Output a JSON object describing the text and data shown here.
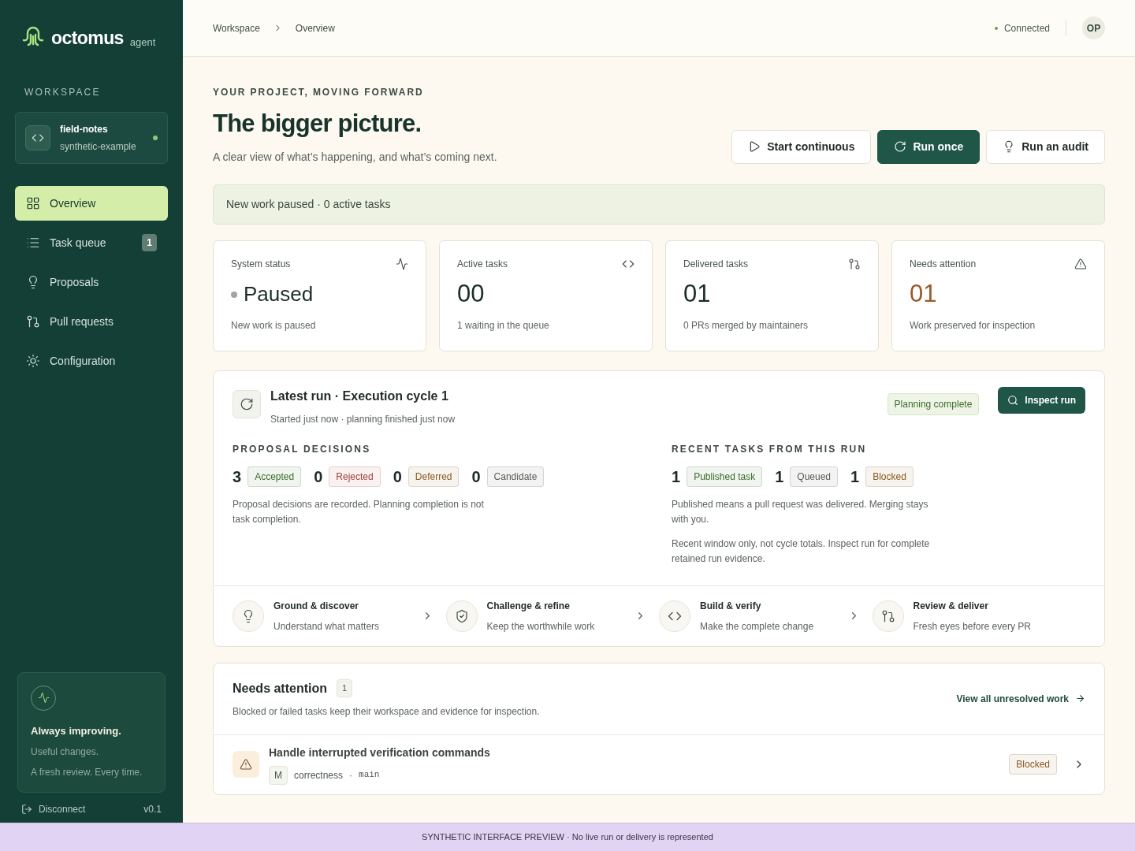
{
  "brand": {
    "name": "octomus",
    "suffix": "agent"
  },
  "sidebar": {
    "section_label": "WORKSPACE",
    "workspace": {
      "name": "field-notes",
      "subtitle": "synthetic-example",
      "online": true
    },
    "items": [
      {
        "label": "Overview",
        "selected": true
      },
      {
        "label": "Task queue",
        "selected": false,
        "badge": "1"
      },
      {
        "label": "Proposals",
        "selected": false
      },
      {
        "label": "Pull requests",
        "selected": false
      },
      {
        "label": "Configuration",
        "selected": false
      }
    ],
    "promo": {
      "title": "Always improving.",
      "lines": [
        "Useful changes.",
        "A fresh review. Every time."
      ]
    },
    "footer": {
      "disconnect": "Disconnect",
      "version": "v0.1"
    }
  },
  "header": {
    "breadcrumbs": [
      "Workspace",
      "Overview"
    ],
    "connection": {
      "label": "Connected",
      "connected": true
    },
    "avatar": "OP"
  },
  "hero": {
    "eyebrow": "YOUR PROJECT, MOVING FORWARD",
    "title": "The bigger picture.",
    "subtitle": "A clear view of what’s happening, and what’s coming next.",
    "buttons": [
      {
        "label": "Start continuous",
        "kind": "outline"
      },
      {
        "label": "Run once",
        "kind": "primary"
      },
      {
        "label": "Run an audit",
        "kind": "outline"
      }
    ]
  },
  "notice": "New work paused · 0 active tasks",
  "stats": [
    {
      "label": "System status",
      "value": "Paused",
      "dot": {
        "color": "#a8a29e"
      },
      "note": "New work is paused",
      "color": "#1b2d28"
    },
    {
      "label": "Active tasks",
      "value": "00",
      "note": "1 waiting in the queue",
      "color": "#1b2d28"
    },
    {
      "label": "Delivered tasks",
      "value": "01",
      "note": "0 PRs merged by maintainers",
      "color": "#1b2d28"
    },
    {
      "label": "Needs attention",
      "value": "01",
      "note": "Work preserved for inspection",
      "color": "#9a5a2a"
    }
  ],
  "latest_run": {
    "title": "Latest run · Execution cycle 1",
    "subtitle": "Started just now · planning finished just now",
    "status": "Planning complete",
    "action": "Inspect run",
    "proposals": {
      "heading": "PROPOSAL DECISIONS",
      "counts": [
        {
          "count": "3",
          "label": "Accepted",
          "color": "#3d6b2e"
        },
        {
          "count": "0",
          "label": "Rejected",
          "color": "#a3413a"
        },
        {
          "count": "0",
          "label": "Deferred",
          "color": "#8a5a1e"
        },
        {
          "count": "0",
          "label": "Candidate",
          "color": "#5b5b55"
        }
      ],
      "notes": [
        "Proposal decisions are recorded. Planning completion is not task completion."
      ]
    },
    "tasks": {
      "heading": "RECENT TASKS FROM THIS RUN",
      "counts": [
        {
          "count": "1",
          "label": "Published task",
          "color": "#3d6b2e"
        },
        {
          "count": "1",
          "label": "Queued",
          "color": "#5b5b55"
        },
        {
          "count": "1",
          "label": "Blocked",
          "color": "#8a5a1e"
        }
      ],
      "notes": [
        "Published means a pull request was delivered. Merging stays with you.",
        "Recent window only, not cycle totals. Inspect run for complete retained run evidence."
      ]
    },
    "stages": [
      {
        "title": "Ground & discover",
        "subtitle": "Understand what matters"
      },
      {
        "title": "Challenge & refine",
        "subtitle": "Keep the worthwhile work"
      },
      {
        "title": "Build & verify",
        "subtitle": "Make the complete change"
      },
      {
        "title": "Review & deliver",
        "subtitle": "Fresh eyes before every PR"
      }
    ]
  },
  "attention": {
    "title": "Needs attention",
    "count": "1",
    "subtitle": "Blocked or failed tasks keep their workspace and evidence for inspection.",
    "link": "View all unresolved work",
    "items": [
      {
        "title": "Handle interrupted verification commands",
        "tag": "M",
        "category": "correctness",
        "separator": "·",
        "branch": "main",
        "status": "Blocked",
        "color": "#8a5a1e"
      }
    ]
  },
  "banner": "SYNTHETIC INTERFACE PREVIEW · No live run or delivery is represented"
}
